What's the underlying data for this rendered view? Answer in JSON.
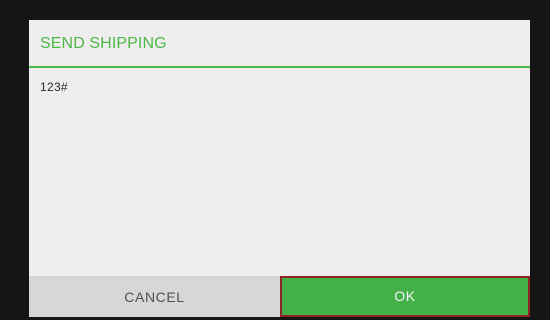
{
  "dialog": {
    "title": "SEND SHIPPING",
    "message": "123#",
    "cancel_label": "CANCEL",
    "ok_label": "OK"
  },
  "colors": {
    "accent": "#4cb848",
    "ok_button": "#44b048",
    "ok_focus_border": "#8e2424",
    "cancel_button": "#d7d7d7",
    "dialog_background": "#eeeeee",
    "backdrop": "#151515"
  }
}
